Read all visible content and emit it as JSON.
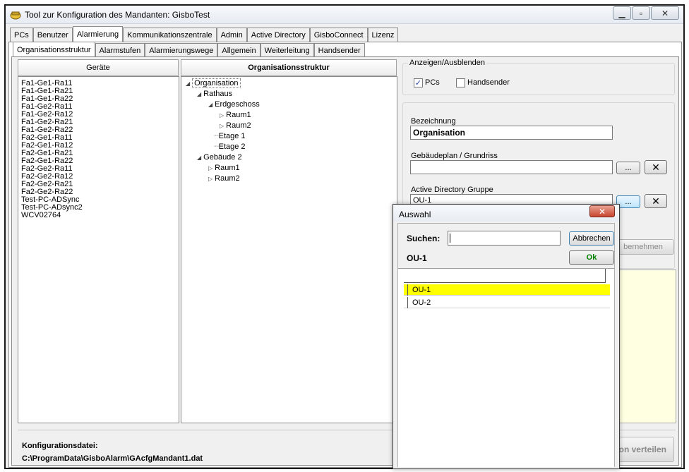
{
  "window": {
    "title": "Tool zur Konfiguration des Mandanten: GisboTest"
  },
  "main_tabs": [
    {
      "label": "PCs"
    },
    {
      "label": "Benutzer"
    },
    {
      "label": "Alarmierung"
    },
    {
      "label": "Kommunikationszentrale"
    },
    {
      "label": "Admin"
    },
    {
      "label": "Active Directory"
    },
    {
      "label": "GisboConnect"
    },
    {
      "label": "Lizenz"
    }
  ],
  "sub_tabs": [
    {
      "label": "Organisationsstruktur"
    },
    {
      "label": "Alarmstufen"
    },
    {
      "label": "Alarmierungswege"
    },
    {
      "label": "Allgemein"
    },
    {
      "label": "Weiterleitung"
    },
    {
      "label": "Handsender"
    }
  ],
  "devices": {
    "header": "Geräte",
    "items": [
      "Fa1-Ge1-Ra11",
      "Fa1-Ge1-Ra21",
      "Fa1-Ge1-Ra22",
      "Fa1-Ge2-Ra11",
      "Fa1-Ge2-Ra12",
      "Fa1-Ge2-Ra21",
      "Fa1-Ge2-Ra22",
      "Fa2-Ge1-Ra11",
      "Fa2-Ge1-Ra12",
      "Fa2-Ge1-Ra21",
      "Fa2-Ge1-Ra22",
      "Fa2-Ge2-Ra11",
      "Fa2-Ge2-Ra12",
      "Fa2-Ge2-Ra21",
      "Fa2-Ge2-Ra22",
      "Test-PC-ADSync",
      "Test-PC-ADsync2",
      "WCV02764"
    ]
  },
  "org": {
    "header": "Organisationsstruktur",
    "tree": [
      {
        "label": "Organisation"
      },
      {
        "label": "Rathaus"
      },
      {
        "label": "Erdgeschoss"
      },
      {
        "label": "Raum1"
      },
      {
        "label": "Raum2"
      },
      {
        "label": "Etage 1"
      },
      {
        "label": "Etage 2"
      },
      {
        "label": "Gebäude 2"
      },
      {
        "label": "Raum1"
      },
      {
        "label": "Raum2"
      }
    ]
  },
  "show_hide": {
    "legend": "Anzeigen/Ausblenden",
    "pcs_label": "PCs",
    "pcs_checked": true,
    "handsender_label": "Handsender",
    "handsender_checked": false
  },
  "details": {
    "bezeichnung_label": "Bezeichnung",
    "bezeichnung_value": "Organisation",
    "plan_label": "Gebäudeplan / Grundriss",
    "plan_value": "",
    "ad_label": "Active Directory Gruppe",
    "ad_value": "OU-1",
    "browse_label": "...",
    "uebernehmen_label": "bernehmen"
  },
  "footer": {
    "config_label": "Konfigurationsdatei:",
    "config_path": "C:\\ProgramData\\GisboAlarm\\GAcfgMandant1.dat",
    "verteilen_label": "on verteilen"
  },
  "dialog": {
    "title": "Auswahl",
    "search_label": "Suchen:",
    "search_value": "",
    "cancel_label": "Abbrechen",
    "ok_label": "Ok",
    "current_value": "OU-1",
    "rows": [
      {
        "value": "OU-1",
        "selected": true
      },
      {
        "value": "OU-2",
        "selected": false
      }
    ]
  },
  "colors": {
    "selected_row": "#ffff00",
    "ok_text": "#008000"
  }
}
